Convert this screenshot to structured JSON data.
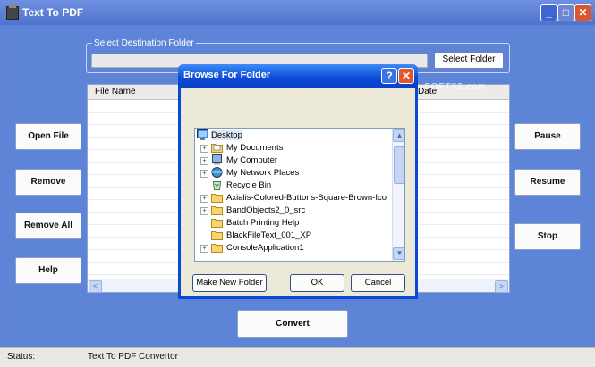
{
  "window": {
    "title": "Text To PDF"
  },
  "destination": {
    "legend": "Select Destination Folder",
    "value": "",
    "select_button": "Select Folder"
  },
  "file_list": {
    "column_header": "File Name",
    "column_header2": "Date"
  },
  "left_buttons": [
    "Open File",
    "Remove",
    "Remove All",
    "Help"
  ],
  "right_buttons": [
    "Pause",
    "Resume",
    "Stop"
  ],
  "convert_button": "Convert",
  "status": {
    "label": "Status:",
    "text": "Text To PDF Convertor"
  },
  "watermark": "SOFT32.com",
  "dialog": {
    "title": "Browse For Folder",
    "tree": [
      {
        "label": "Desktop",
        "icon": "desktop-icon",
        "expander": "",
        "level": 0
      },
      {
        "label": "My Documents",
        "icon": "folder-icon",
        "expander": "+",
        "level": 1
      },
      {
        "label": "My Computer",
        "icon": "computer-icon",
        "expander": "+",
        "level": 1
      },
      {
        "label": "My Network Places",
        "icon": "network-icon",
        "expander": "+",
        "level": 1
      },
      {
        "label": "Recycle Bin",
        "icon": "recycle-bin-icon",
        "expander": "",
        "level": 1
      },
      {
        "label": "Axialis-Colored-Buttons-Square-Brown-Ico",
        "icon": "folder-icon",
        "expander": "+",
        "level": 1
      },
      {
        "label": "BandObjects2_0_src",
        "icon": "folder-icon",
        "expander": "+",
        "level": 1
      },
      {
        "label": "Batch Printing Help",
        "icon": "folder-icon",
        "expander": "",
        "level": 1
      },
      {
        "label": "BlackFileText_001_XP",
        "icon": "folder-icon",
        "expander": "",
        "level": 1
      },
      {
        "label": "ConsoleApplication1",
        "icon": "folder-icon",
        "expander": "+",
        "level": 1
      }
    ],
    "buttons": {
      "new_folder": "Make New Folder",
      "ok": "OK",
      "cancel": "Cancel"
    }
  },
  "colors": {
    "window_bg": "#5e84d8",
    "dialog_title": "#0a49d6",
    "close": "#e1572b"
  }
}
